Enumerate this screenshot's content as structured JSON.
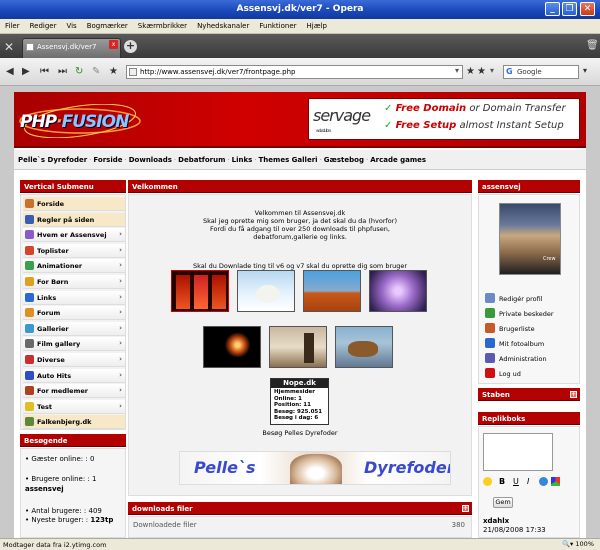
{
  "window": {
    "title": "Assensvj.dk/ver7 - Opera"
  },
  "menu": [
    "Filer",
    "Rediger",
    "Vis",
    "Bogmærker",
    "Skærmbrikker",
    "Nyhedskanaler",
    "Funktioner",
    "Hjælp"
  ],
  "tab": {
    "label": "Assensvj.dk/ver7"
  },
  "address": {
    "url": "http://www.assensvej.dk/ver7/frontpage.php",
    "search_placeholder": "Google"
  },
  "header": {
    "logo_left": "PHP",
    "logo_right": "FUSION",
    "ad_brand": "servage",
    "ad_brand_sub": "web solutions",
    "ad_line1_bold": "Free Domain",
    "ad_line1_rest": " or Domain Transfer",
    "ad_line2_bold": "Free Setup",
    "ad_line2_rest": " almost Instant Setup",
    "check": "✓"
  },
  "navlinks": [
    "Pelle`s Dyrefoder",
    "Forside",
    "Downloads",
    "Debatforum",
    "Links",
    "Themes Galleri",
    "Gæstebog",
    "Arcade games"
  ],
  "left": {
    "title": "Vertical Submenu",
    "items": [
      {
        "label": "Forside",
        "color": "#c8702c",
        "arrow": false
      },
      {
        "label": "Regler på siden",
        "color": "#3a5db0",
        "arrow": false
      },
      {
        "label": "Hvem er Assensvej",
        "color": "#8a5ac8",
        "arrow": true
      },
      {
        "label": "Toplister",
        "color": "#d4452c",
        "arrow": true
      },
      {
        "label": "Animationer",
        "color": "#3aa04a",
        "arrow": true
      },
      {
        "label": "For Børn",
        "color": "#e0a020",
        "arrow": true
      },
      {
        "label": "Links",
        "color": "#2a6ad0",
        "arrow": true
      },
      {
        "label": "Forum",
        "color": "#e09020",
        "arrow": true
      },
      {
        "label": "Gallerier",
        "color": "#3a9ad0",
        "arrow": true
      },
      {
        "label": "Film gallery",
        "color": "#6a6a6a",
        "arrow": true
      },
      {
        "label": "Diverse",
        "color": "#c83030",
        "arrow": true
      },
      {
        "label": "Auto Hits",
        "color": "#3050c0",
        "arrow": true
      },
      {
        "label": "For medlemer",
        "color": "#b04020",
        "arrow": true
      },
      {
        "label": "Test",
        "color": "#e0c020",
        "arrow": true
      },
      {
        "label": "Falkenbjerg.dk",
        "color": "#5a8a3a",
        "arrow": false
      }
    ],
    "visitors_title": "Besøgende",
    "guests": "• Gæster online: : 0",
    "members": "• Brugere online: : 1",
    "member_name": "assensvej",
    "total": "• Antal brugere: : 409",
    "newest_label": "• Nyeste bruger: : ",
    "newest_name": "123tp"
  },
  "center": {
    "title": "Velkommen",
    "welcome": [
      "Velkommen til Assensvej.dk",
      "Skal jeg oprette mig som bruger, ja det skal du da (hvorfor)",
      "Fordi du få adgang til over 250 downloads til phpfusen,",
      "debatforum,gallerie og links."
    ],
    "download_line": "Skal du Downlade ting til v6 og v7 skal du oprette dig som bruger",
    "counter": {
      "title": "Nope.dk",
      "lines": [
        "Hjemmesider",
        "Online:   1",
        "Position:   11",
        "Besøg:  925.051",
        "Besøg i dag:   6"
      ]
    },
    "visit_text": "Besøg Pelles Dyrefoder",
    "banner_left": "Pelle`s",
    "banner_right": "Dyrefoder",
    "downloads_title": "downloads filer",
    "downloads_row": "Downloadede filer",
    "downloads_count": "380"
  },
  "right": {
    "user_title": "assensvej",
    "avatar_text": "Crew",
    "items": [
      {
        "label": "Redigér profil",
        "color": "#6a8ac8"
      },
      {
        "label": "Private beskeder",
        "color": "#3a9a3a"
      },
      {
        "label": "Brugerliste",
        "color": "#c85a2a"
      },
      {
        "label": "Mit fotoalbum",
        "color": "#2a6ad0"
      },
      {
        "label": "Administration",
        "color": "#5a5ab0"
      },
      {
        "label": "Log ud",
        "color": "#d01010"
      }
    ],
    "staben_title": "Staben",
    "reply_title": "Replikboks",
    "format_bold": "B",
    "format_underline": "U",
    "format_italic": "I",
    "submit": "Gem",
    "shout_user": "xdahlx",
    "shout_date": "21/08/2008 17:33"
  },
  "status": {
    "text": "Modtager data fra i2.ytimg.com",
    "zoom": "100%"
  }
}
